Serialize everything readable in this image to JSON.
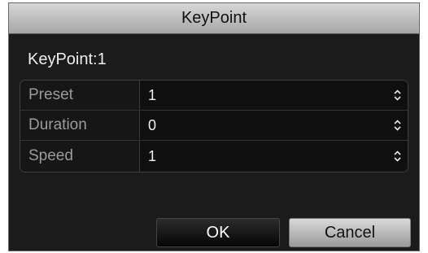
{
  "dialog": {
    "title": "KeyPoint",
    "section_label": "KeyPoint:1",
    "fields": [
      {
        "label": "Preset",
        "value": "1"
      },
      {
        "label": "Duration",
        "value": "0"
      },
      {
        "label": "Speed",
        "value": "1"
      }
    ],
    "ok_label": "OK",
    "cancel_label": "Cancel"
  },
  "icons": {
    "spinner": "up-down-spinner-icon"
  }
}
